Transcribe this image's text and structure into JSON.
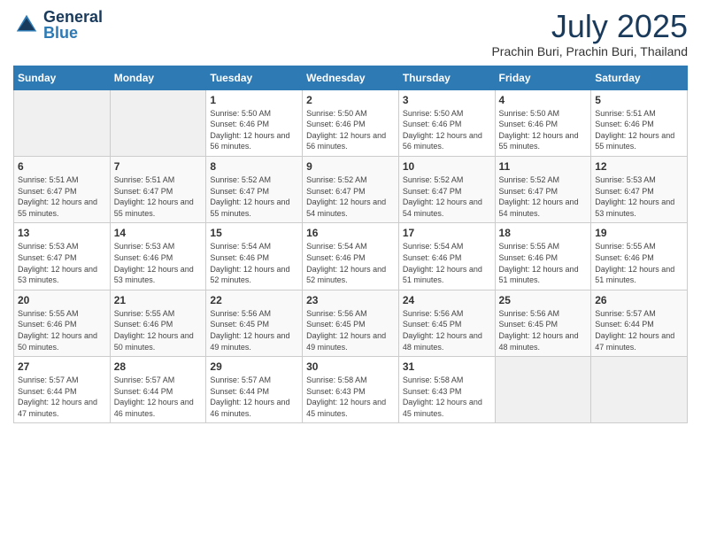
{
  "header": {
    "logo_general": "General",
    "logo_blue": "Blue",
    "title": "July 2025",
    "location": "Prachin Buri, Prachin Buri, Thailand"
  },
  "weekdays": [
    "Sunday",
    "Monday",
    "Tuesday",
    "Wednesday",
    "Thursday",
    "Friday",
    "Saturday"
  ],
  "weeks": [
    [
      {
        "day": "",
        "empty": true
      },
      {
        "day": "",
        "empty": true
      },
      {
        "day": "1",
        "sunrise": "Sunrise: 5:50 AM",
        "sunset": "Sunset: 6:46 PM",
        "daylight": "Daylight: 12 hours and 56 minutes."
      },
      {
        "day": "2",
        "sunrise": "Sunrise: 5:50 AM",
        "sunset": "Sunset: 6:46 PM",
        "daylight": "Daylight: 12 hours and 56 minutes."
      },
      {
        "day": "3",
        "sunrise": "Sunrise: 5:50 AM",
        "sunset": "Sunset: 6:46 PM",
        "daylight": "Daylight: 12 hours and 56 minutes."
      },
      {
        "day": "4",
        "sunrise": "Sunrise: 5:50 AM",
        "sunset": "Sunset: 6:46 PM",
        "daylight": "Daylight: 12 hours and 55 minutes."
      },
      {
        "day": "5",
        "sunrise": "Sunrise: 5:51 AM",
        "sunset": "Sunset: 6:46 PM",
        "daylight": "Daylight: 12 hours and 55 minutes."
      }
    ],
    [
      {
        "day": "6",
        "sunrise": "Sunrise: 5:51 AM",
        "sunset": "Sunset: 6:47 PM",
        "daylight": "Daylight: 12 hours and 55 minutes."
      },
      {
        "day": "7",
        "sunrise": "Sunrise: 5:51 AM",
        "sunset": "Sunset: 6:47 PM",
        "daylight": "Daylight: 12 hours and 55 minutes."
      },
      {
        "day": "8",
        "sunrise": "Sunrise: 5:52 AM",
        "sunset": "Sunset: 6:47 PM",
        "daylight": "Daylight: 12 hours and 55 minutes."
      },
      {
        "day": "9",
        "sunrise": "Sunrise: 5:52 AM",
        "sunset": "Sunset: 6:47 PM",
        "daylight": "Daylight: 12 hours and 54 minutes."
      },
      {
        "day": "10",
        "sunrise": "Sunrise: 5:52 AM",
        "sunset": "Sunset: 6:47 PM",
        "daylight": "Daylight: 12 hours and 54 minutes."
      },
      {
        "day": "11",
        "sunrise": "Sunrise: 5:52 AM",
        "sunset": "Sunset: 6:47 PM",
        "daylight": "Daylight: 12 hours and 54 minutes."
      },
      {
        "day": "12",
        "sunrise": "Sunrise: 5:53 AM",
        "sunset": "Sunset: 6:47 PM",
        "daylight": "Daylight: 12 hours and 53 minutes."
      }
    ],
    [
      {
        "day": "13",
        "sunrise": "Sunrise: 5:53 AM",
        "sunset": "Sunset: 6:47 PM",
        "daylight": "Daylight: 12 hours and 53 minutes."
      },
      {
        "day": "14",
        "sunrise": "Sunrise: 5:53 AM",
        "sunset": "Sunset: 6:46 PM",
        "daylight": "Daylight: 12 hours and 53 minutes."
      },
      {
        "day": "15",
        "sunrise": "Sunrise: 5:54 AM",
        "sunset": "Sunset: 6:46 PM",
        "daylight": "Daylight: 12 hours and 52 minutes."
      },
      {
        "day": "16",
        "sunrise": "Sunrise: 5:54 AM",
        "sunset": "Sunset: 6:46 PM",
        "daylight": "Daylight: 12 hours and 52 minutes."
      },
      {
        "day": "17",
        "sunrise": "Sunrise: 5:54 AM",
        "sunset": "Sunset: 6:46 PM",
        "daylight": "Daylight: 12 hours and 51 minutes."
      },
      {
        "day": "18",
        "sunrise": "Sunrise: 5:55 AM",
        "sunset": "Sunset: 6:46 PM",
        "daylight": "Daylight: 12 hours and 51 minutes."
      },
      {
        "day": "19",
        "sunrise": "Sunrise: 5:55 AM",
        "sunset": "Sunset: 6:46 PM",
        "daylight": "Daylight: 12 hours and 51 minutes."
      }
    ],
    [
      {
        "day": "20",
        "sunrise": "Sunrise: 5:55 AM",
        "sunset": "Sunset: 6:46 PM",
        "daylight": "Daylight: 12 hours and 50 minutes."
      },
      {
        "day": "21",
        "sunrise": "Sunrise: 5:55 AM",
        "sunset": "Sunset: 6:46 PM",
        "daylight": "Daylight: 12 hours and 50 minutes."
      },
      {
        "day": "22",
        "sunrise": "Sunrise: 5:56 AM",
        "sunset": "Sunset: 6:45 PM",
        "daylight": "Daylight: 12 hours and 49 minutes."
      },
      {
        "day": "23",
        "sunrise": "Sunrise: 5:56 AM",
        "sunset": "Sunset: 6:45 PM",
        "daylight": "Daylight: 12 hours and 49 minutes."
      },
      {
        "day": "24",
        "sunrise": "Sunrise: 5:56 AM",
        "sunset": "Sunset: 6:45 PM",
        "daylight": "Daylight: 12 hours and 48 minutes."
      },
      {
        "day": "25",
        "sunrise": "Sunrise: 5:56 AM",
        "sunset": "Sunset: 6:45 PM",
        "daylight": "Daylight: 12 hours and 48 minutes."
      },
      {
        "day": "26",
        "sunrise": "Sunrise: 5:57 AM",
        "sunset": "Sunset: 6:44 PM",
        "daylight": "Daylight: 12 hours and 47 minutes."
      }
    ],
    [
      {
        "day": "27",
        "sunrise": "Sunrise: 5:57 AM",
        "sunset": "Sunset: 6:44 PM",
        "daylight": "Daylight: 12 hours and 47 minutes."
      },
      {
        "day": "28",
        "sunrise": "Sunrise: 5:57 AM",
        "sunset": "Sunset: 6:44 PM",
        "daylight": "Daylight: 12 hours and 46 minutes."
      },
      {
        "day": "29",
        "sunrise": "Sunrise: 5:57 AM",
        "sunset": "Sunset: 6:44 PM",
        "daylight": "Daylight: 12 hours and 46 minutes."
      },
      {
        "day": "30",
        "sunrise": "Sunrise: 5:58 AM",
        "sunset": "Sunset: 6:43 PM",
        "daylight": "Daylight: 12 hours and 45 minutes."
      },
      {
        "day": "31",
        "sunrise": "Sunrise: 5:58 AM",
        "sunset": "Sunset: 6:43 PM",
        "daylight": "Daylight: 12 hours and 45 minutes."
      },
      {
        "day": "",
        "empty": true
      },
      {
        "day": "",
        "empty": true
      }
    ]
  ]
}
